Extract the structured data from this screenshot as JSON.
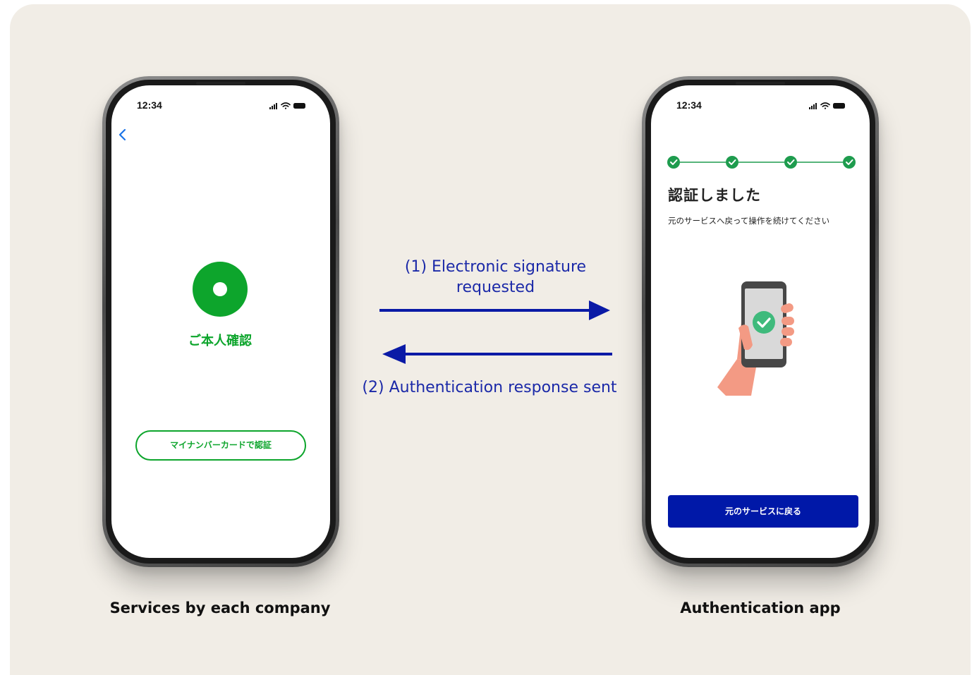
{
  "left_phone": {
    "status_time": "12:34",
    "identity_title": "ご本人確認",
    "auth_button_label": "マイナンバーカードで認証",
    "caption": "Services by each company"
  },
  "right_phone": {
    "status_time": "12:34",
    "title": "認証しました",
    "subtitle": "元のサービスへ戻って操作を続けてください",
    "return_button_label": "元のサービスに戻る",
    "caption": "Authentication app",
    "steps_completed": 4,
    "steps_total": 4
  },
  "flow": {
    "request_label_line1": "(1)  Electronic signature",
    "request_label_line2": "requested",
    "response_label": "(2) Authentication response sent"
  },
  "colors": {
    "background": "#f1ede6",
    "brand_green": "#0da52c",
    "step_green": "#1e9c4e",
    "primary_blue": "#0018a8",
    "arrow_blue": "#0a1aa6",
    "label_blue": "#1b29a8"
  }
}
